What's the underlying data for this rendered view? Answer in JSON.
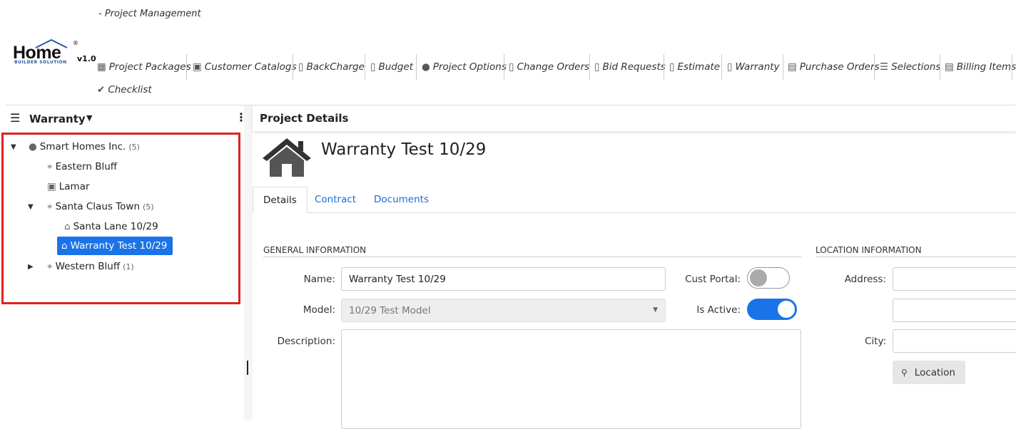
{
  "app": {
    "subtitle": "- Project Management",
    "logo_text": "Home",
    "logo_sub": "BUILDER SOLUTION",
    "version": "v1.0"
  },
  "menu": [
    {
      "label": "Project Packages",
      "icon": "package-icon"
    },
    {
      "label": "Customer Catalogs",
      "icon": "catalog-icon"
    },
    {
      "label": "BackCharge",
      "icon": "document-icon"
    },
    {
      "label": "Budget",
      "icon": "document-icon"
    },
    {
      "label": "Project Options",
      "icon": "user-icon"
    },
    {
      "label": "Change Orders",
      "icon": "document-icon"
    },
    {
      "label": "Bid Requests",
      "icon": "document-icon"
    },
    {
      "label": "Estimate",
      "icon": "document-icon"
    },
    {
      "label": "Warranty",
      "icon": "document-icon"
    },
    {
      "label": "Purchase Orders",
      "icon": "document-icon"
    },
    {
      "label": "Selections",
      "icon": "list-icon"
    },
    {
      "label": "Billing Items",
      "icon": "list-icon"
    },
    {
      "label": "Checklist",
      "icon": "check-icon"
    }
  ],
  "left_panel": {
    "title": "Warranty"
  },
  "tree": {
    "root": {
      "label": "Smart Homes Inc.",
      "count": "(5)"
    },
    "eastern": {
      "label": "Eastern Bluff"
    },
    "lamar": {
      "label": "Lamar"
    },
    "santa_claus": {
      "label": "Santa Claus Town",
      "count": "(5)"
    },
    "santa_lane": {
      "label": "Santa Lane 10/29"
    },
    "warranty_test": {
      "label": "Warranty Test 10/29"
    },
    "western": {
      "label": "Western Bluff",
      "count": "(1)"
    }
  },
  "right_panel": {
    "header": "Project Details",
    "project_title": "Warranty Test 10/29"
  },
  "tabs": [
    {
      "label": "Details"
    },
    {
      "label": "Contract"
    },
    {
      "label": "Documents"
    }
  ],
  "general": {
    "section_title": "GENERAL INFORMATION",
    "name_label": "Name:",
    "name_value": "Warranty Test 10/29",
    "model_label": "Model:",
    "model_value": "10/29 Test Model",
    "description_label": "Description:",
    "cust_portal_label": "Cust Portal:",
    "is_active_label": "Is Active:",
    "cust_portal_on": false,
    "is_active_on": true
  },
  "location": {
    "section_title": "LOCATION INFORMATION",
    "address_label": "Address:",
    "city_label": "City:",
    "location_button": "Location"
  },
  "colors": {
    "accent": "#1a73e8",
    "highlight_border": "#e02020"
  }
}
